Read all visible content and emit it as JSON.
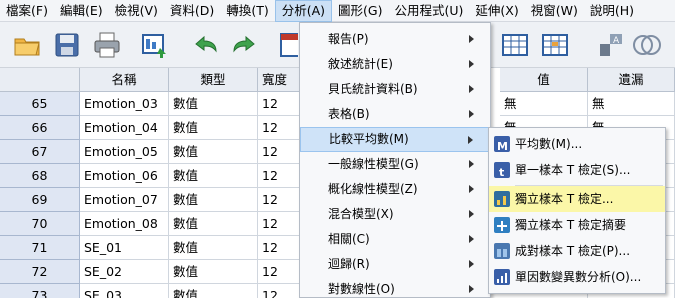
{
  "menubar": {
    "items": [
      "檔案(F)",
      "編輯(E)",
      "檢視(V)",
      "資料(D)",
      "轉換(T)",
      "分析(A)",
      "圖形(G)",
      "公用程式(U)",
      "延伸(X)",
      "視窗(W)",
      "說明(H)"
    ],
    "active": "分析(A)"
  },
  "toolbar": {
    "icons": [
      "open-folder-icon",
      "save-icon",
      "print-icon",
      "dialog-recall-icon",
      "undo-icon",
      "redo-icon",
      "goto-icon",
      "data-table-icon",
      "value-labels-grid-icon",
      "variable-sets-icon",
      "venn-icon"
    ]
  },
  "grid": {
    "headers": {
      "name": "名稱",
      "type": "類型",
      "width": "寬度",
      "values": "值",
      "missing": "遺漏"
    },
    "rows": [
      {
        "num": "65",
        "name": "Emotion_03",
        "type": "數值",
        "width": "12",
        "values": "無",
        "missing": "無"
      },
      {
        "num": "66",
        "name": "Emotion_04",
        "type": "數值",
        "width": "12",
        "values": "無",
        "missing": "無"
      },
      {
        "num": "67",
        "name": "Emotion_05",
        "type": "數值",
        "width": "12",
        "values": "",
        "missing": ""
      },
      {
        "num": "68",
        "name": "Emotion_06",
        "type": "數值",
        "width": "12",
        "values": "",
        "missing": ""
      },
      {
        "num": "69",
        "name": "Emotion_07",
        "type": "數值",
        "width": "12",
        "values": "",
        "missing": ""
      },
      {
        "num": "70",
        "name": "Emotion_08",
        "type": "數值",
        "width": "12",
        "values": "",
        "missing": ""
      },
      {
        "num": "71",
        "name": "SE_01",
        "type": "數值",
        "width": "12",
        "values": "",
        "missing": ""
      },
      {
        "num": "72",
        "name": "SE_02",
        "type": "數值",
        "width": "12",
        "values": "",
        "missing": ""
      },
      {
        "num": "73",
        "name": "SE_03",
        "type": "數值",
        "width": "12",
        "values": "",
        "missing": ""
      }
    ]
  },
  "analyze_menu": {
    "items": [
      "報告(P)",
      "敘述統計(E)",
      "貝氏統計資料(B)",
      "表格(B)",
      "比較平均數(M)",
      "一般線性模型(G)",
      "概化線性模型(Z)",
      "混合模型(X)",
      "相關(C)",
      "迴歸(R)",
      "對數線性(O)"
    ],
    "highlighted": "比較平均數(M)"
  },
  "compare_submenu": {
    "items": [
      {
        "label": "平均數(M)...",
        "icon": "means-icon",
        "color": "#3a5fa8"
      },
      {
        "label": "單一樣本 T 檢定(S)...",
        "icon": "one-sample-t-icon",
        "color": "#3a5fa8"
      },
      {
        "label": "獨立樣本 T 檢定...",
        "icon": "independent-t-icon",
        "color": "#2f6e9e"
      },
      {
        "label": "獨立樣本 T 檢定摘要",
        "icon": "summary-t-icon",
        "color": "#2f7fc1"
      },
      {
        "label": "成對樣本 T 檢定(P)...",
        "icon": "paired-t-icon",
        "color": "#4a78b0"
      },
      {
        "label": "單因數變異數分析(O)...",
        "icon": "anova-icon",
        "color": "#3a5fa8"
      }
    ],
    "highlighted": "獨立樣本 T 檢定..."
  },
  "colors": {
    "menu_highlight": "#cfe3f8",
    "submenu_highlight": "#fbf7a8",
    "row_header": "#dfe6f3"
  }
}
